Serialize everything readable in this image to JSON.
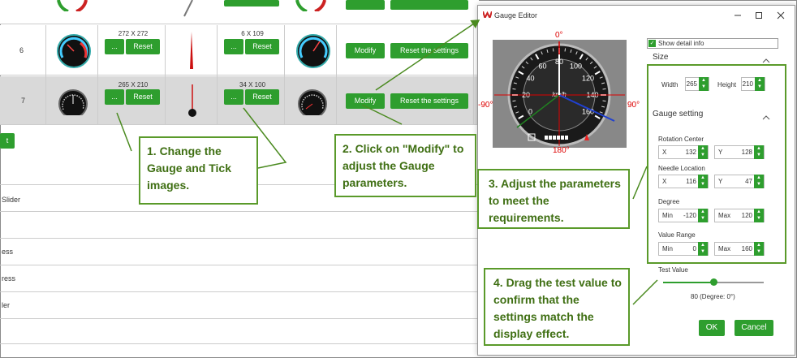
{
  "table": {
    "rows": [
      {
        "index": "6",
        "gauge_size": "272 X 272",
        "tick_size": "6 X 109",
        "btn_dots": "...",
        "btn_reset": "Reset",
        "btn_modify": "Modify",
        "btn_reset_settings": "Reset the settings"
      },
      {
        "index": "7",
        "gauge_size": "265 X 210",
        "tick_size": "34 X 100",
        "btn_dots": "...",
        "btn_reset": "Reset",
        "btn_modify": "Modify",
        "btn_reset_settings": "Reset the settings"
      }
    ],
    "top_partial": {
      "btn_modify": "Modify",
      "btn_reset_settings": "Reset the settings"
    },
    "side_button": "t",
    "list_items": [
      "Slider",
      "ess",
      "ress",
      "ler"
    ]
  },
  "dialog": {
    "title": "Gauge Editor",
    "show_detail_label": "Show detail info",
    "show_detail_checked": true,
    "size_section": "Size",
    "width_label": "Width",
    "width_value": "265",
    "height_label": "Height",
    "height_value": "210",
    "gauge_setting_section": "Gauge setting",
    "rotation_center_label": "Rotation Center",
    "rc_x_label": "X",
    "rc_x_value": "132",
    "rc_y_label": "Y",
    "rc_y_value": "128",
    "needle_location_label": "Needle Location",
    "nl_x_label": "X",
    "nl_x_value": "116",
    "nl_y_label": "Y",
    "nl_y_value": "47",
    "degree_label": "Degree",
    "deg_min_label": "Min",
    "deg_min_value": "-120",
    "deg_max_label": "Max",
    "deg_max_value": "120",
    "value_range_label": "Value Range",
    "vr_min_label": "Min",
    "vr_min_value": "0",
    "vr_max_label": "Max",
    "vr_max_value": "160",
    "test_value_label": "Test Value",
    "test_value_fraction": 0.5,
    "test_value_readout": "80 (Degree: 0°)",
    "ok_label": "OK",
    "cancel_label": "Cancel",
    "gauge": {
      "deg_top": "0°",
      "deg_left": "-90°",
      "deg_right": "90°",
      "deg_bottom": "180°",
      "unit": "km/h",
      "ticks": [
        "0",
        "20",
        "40",
        "60",
        "80",
        "100",
        "120",
        "140",
        "160"
      ]
    }
  },
  "callouts": {
    "c1": "1. Change the Gauge and Tick images.",
    "c2": "2. Click on \"Modify\" to adjust the Gauge parameters.",
    "c3": "3. Adjust the parameters to meet the requirements.",
    "c4": "4. Drag the test value to confirm that the settings match the display effect."
  },
  "colors": {
    "green_button": "#2e9e2e",
    "callout_border": "#5a9a2a",
    "callout_text": "#3f6f13",
    "degree_red": "#dd0000"
  }
}
